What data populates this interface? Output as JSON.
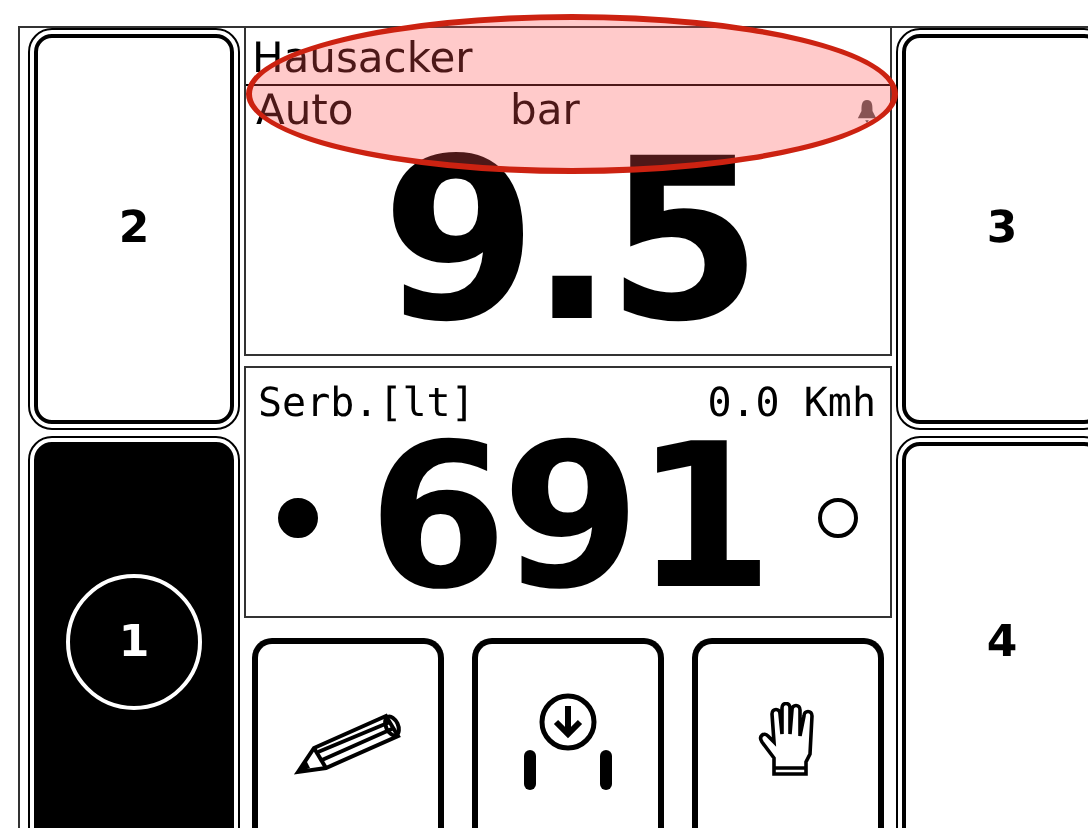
{
  "side_buttons": [
    {
      "label": "2",
      "selected": false
    },
    {
      "label": "1",
      "selected": true
    },
    {
      "label": "3",
      "selected": false
    },
    {
      "label": "4",
      "selected": false
    }
  ],
  "header": {
    "title": "Hausacker",
    "mode": "Auto",
    "unit": "bar"
  },
  "pressure": {
    "value": "9.5"
  },
  "tank": {
    "label": "Serb.[lt]",
    "speed": "0.0 Kmh",
    "value": "691",
    "left_indicator": {
      "on": true
    },
    "right_indicator": {
      "on": false
    }
  },
  "toolbar": [
    {
      "kind": "pencil"
    },
    {
      "kind": "download"
    },
    {
      "kind": "hand"
    }
  ]
}
